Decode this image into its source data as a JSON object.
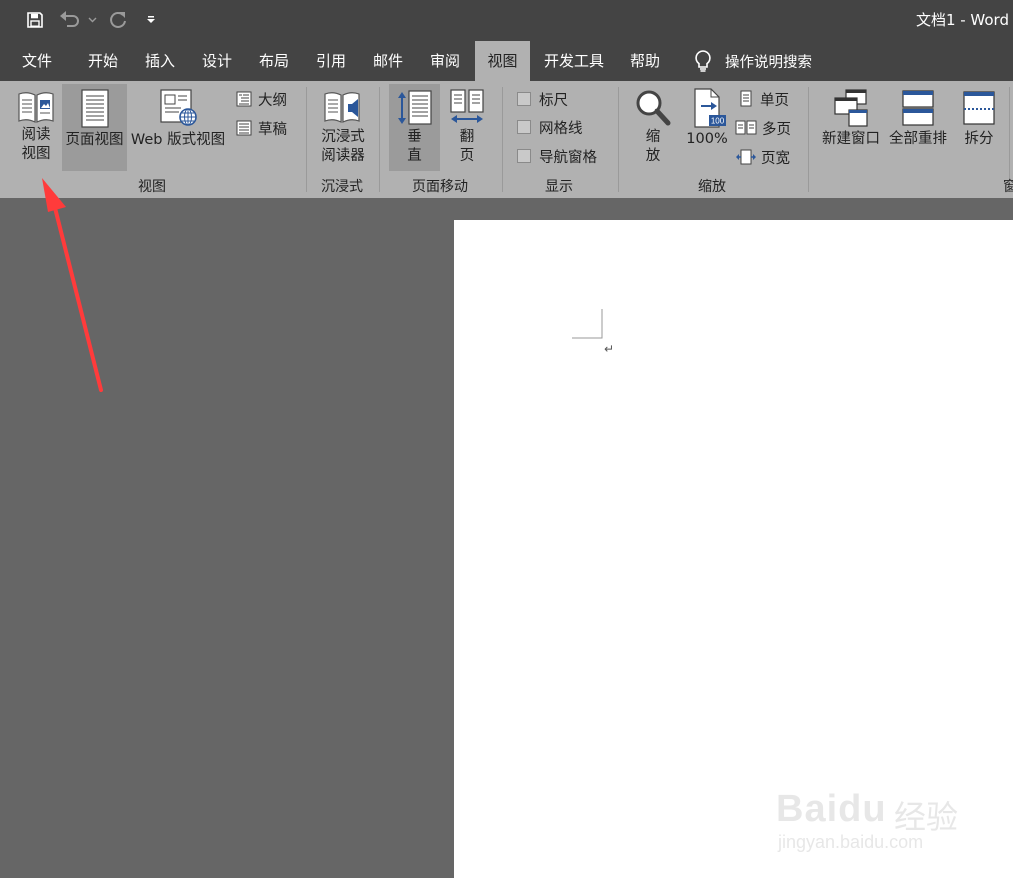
{
  "title_bar": {
    "doc_title": "文档1  -  Word",
    "quick_access": [
      {
        "icon": "save-icon",
        "label": ""
      },
      {
        "icon": "undo-icon",
        "label": ""
      },
      {
        "icon": "redo-icon",
        "label": ""
      },
      {
        "icon": "customize-quick-access-icon",
        "label": ""
      }
    ]
  },
  "menu": {
    "tabs": [
      "文件",
      "开始",
      "插入",
      "设计",
      "布局",
      "引用",
      "邮件",
      "审阅",
      "视图",
      "开发工具",
      "帮助"
    ],
    "active_tab": "视图",
    "tell_me": "操作说明搜索"
  },
  "ribbon": {
    "views": {
      "group_label": "视图",
      "read_mode": "阅读\n视图",
      "read_mode_line1": "阅读",
      "read_mode_line2": "视图",
      "print_layout": "页面视图",
      "web_layout": "Web 版式视图",
      "outline": "大纲",
      "draft": "草稿"
    },
    "immersive": {
      "group_label": "沉浸式",
      "reader_line1": "沉浸式",
      "reader_line2": "阅读器"
    },
    "page_movement": {
      "group_label": "页面移动",
      "vertical_line1": "垂",
      "vertical_line2": "直",
      "side_line1": "翻",
      "side_line2": "页"
    },
    "show": {
      "group_label": "显示",
      "ruler": "标尺",
      "gridlines": "网格线",
      "nav_pane": "导航窗格"
    },
    "zoom": {
      "group_label": "缩放",
      "zoom_line1": "缩",
      "zoom_line2": "放",
      "percent": "100%",
      "percent_badge": "100",
      "one_page": "单页",
      "multiple_pages": "多页",
      "page_width": "页宽"
    },
    "window": {
      "group_label": "窗",
      "new_window": "新建窗口",
      "arrange_all": "全部重排",
      "split": "拆分"
    }
  },
  "document": {
    "paragraph_mark": "↵"
  },
  "watermark": {
    "logo": "Baidu",
    "cn": "经验",
    "url": "jingyan.baidu.com"
  },
  "colors": {
    "title_bar": "#444444",
    "ribbon": "#b1b1b1",
    "canvas": "#666666",
    "page": "#ffffff",
    "accent_blue": "#2b579a",
    "annotation_arrow": "#ff3b3b"
  }
}
